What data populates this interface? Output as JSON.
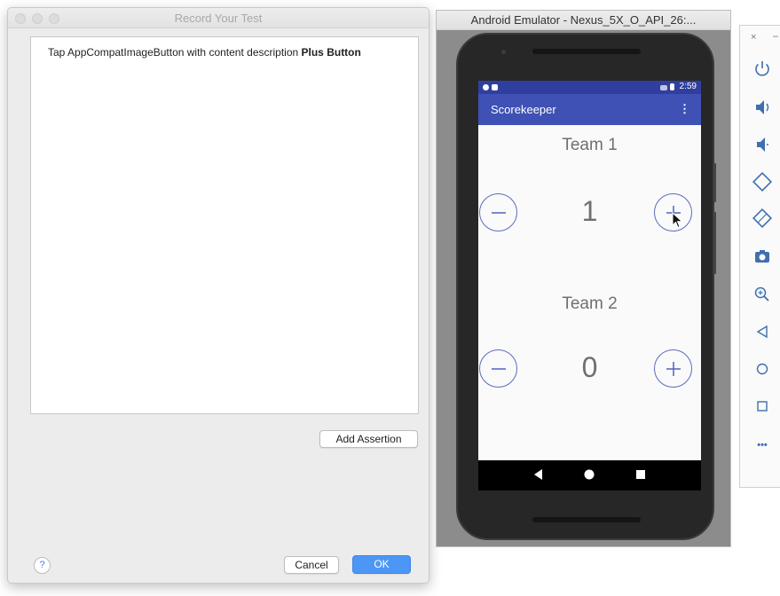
{
  "record_dialog": {
    "title": "Record Your Test",
    "log_prefix": "Tap AppCompatImageButton with content description ",
    "log_target": "Plus Button",
    "add_assertion_label": "Add Assertion",
    "cancel_label": "Cancel",
    "ok_label": "OK",
    "help_label": "?"
  },
  "emulator": {
    "title": "Android Emulator - Nexus_5X_O_API_26:...",
    "status_time": "2:59",
    "app_title": "Scorekeeper",
    "overflow_menu": "⋮",
    "team1": {
      "label": "Team 1",
      "score": "1"
    },
    "team2": {
      "label": "Team 2",
      "score": "0"
    }
  },
  "sidebar": {
    "close": "×",
    "minimize": "–",
    "tools": [
      "power-icon",
      "volume-up-icon",
      "volume-down-icon",
      "rotate-left-icon",
      "rotate-right-icon",
      "camera-icon",
      "zoom-icon",
      "back-icon",
      "home-icon",
      "overview-icon",
      "more-icon"
    ],
    "more_label": "•••"
  },
  "colors": {
    "app_bar": "#3f51b5",
    "status_bar": "#303f9f",
    "button_accent": "#5c6bc0",
    "ok_button": "#4d96f5"
  }
}
